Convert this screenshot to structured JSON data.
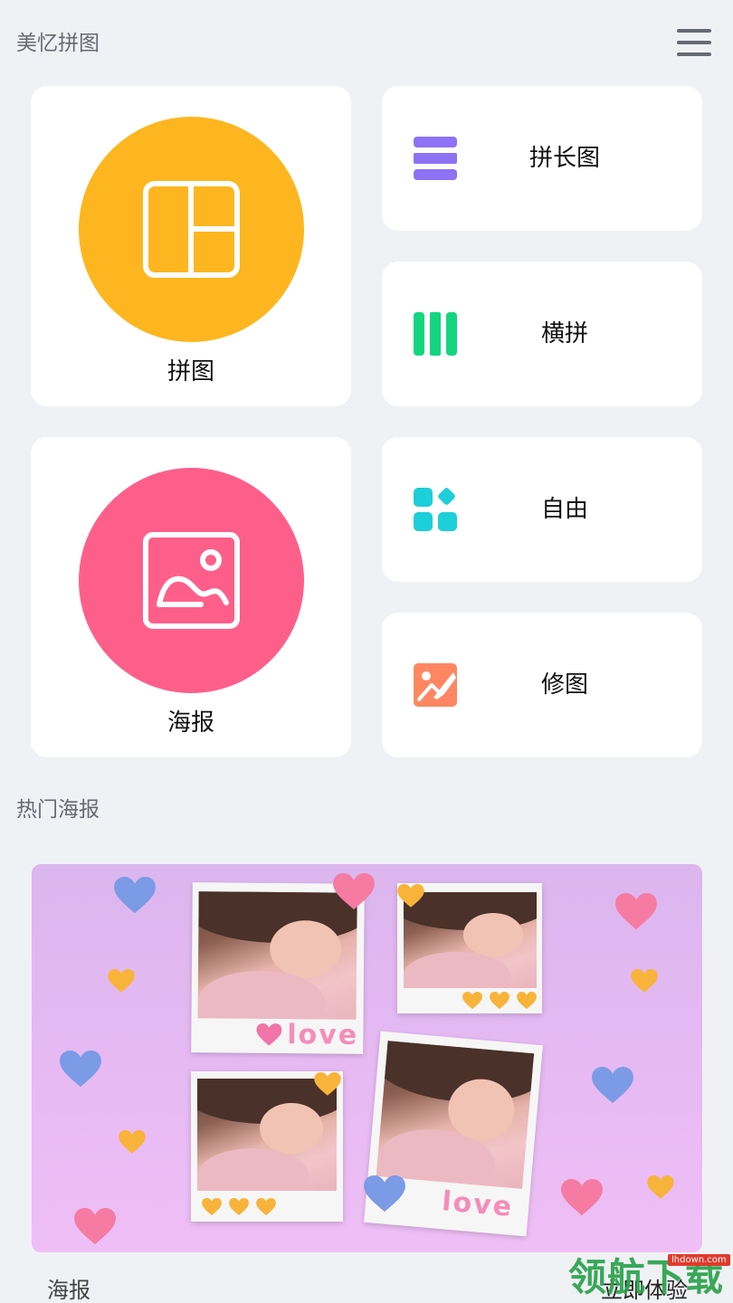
{
  "header": {
    "title": "美忆拼图",
    "menu_icon": "hamburger-menu-icon"
  },
  "features": {
    "collage": {
      "label": "拼图",
      "color": "#fdb61f",
      "icon": "layout-grid-icon"
    },
    "poster": {
      "label": "海报",
      "color": "#fe5f8a",
      "icon": "image-icon"
    },
    "long_stitch": {
      "label": "拼长图",
      "color": "#8c72f4",
      "icon": "stacked-rows-icon"
    },
    "horizontal_stitch": {
      "label": "横拼",
      "color": "#12d67f",
      "icon": "columns-icon"
    },
    "free": {
      "label": "自由",
      "color": "#1dcfd9",
      "icon": "shapes-icon"
    },
    "edit": {
      "label": "修图",
      "color": "#fe8761",
      "icon": "photo-edit-icon"
    }
  },
  "hot_posters": {
    "title": "热门海报",
    "banner": {
      "love_text_1": "love",
      "love_text_2": "love"
    },
    "item_label": "海报",
    "cta_label": "立即体验"
  },
  "watermark": {
    "text": "领航下载",
    "url": "lhdown.com"
  }
}
